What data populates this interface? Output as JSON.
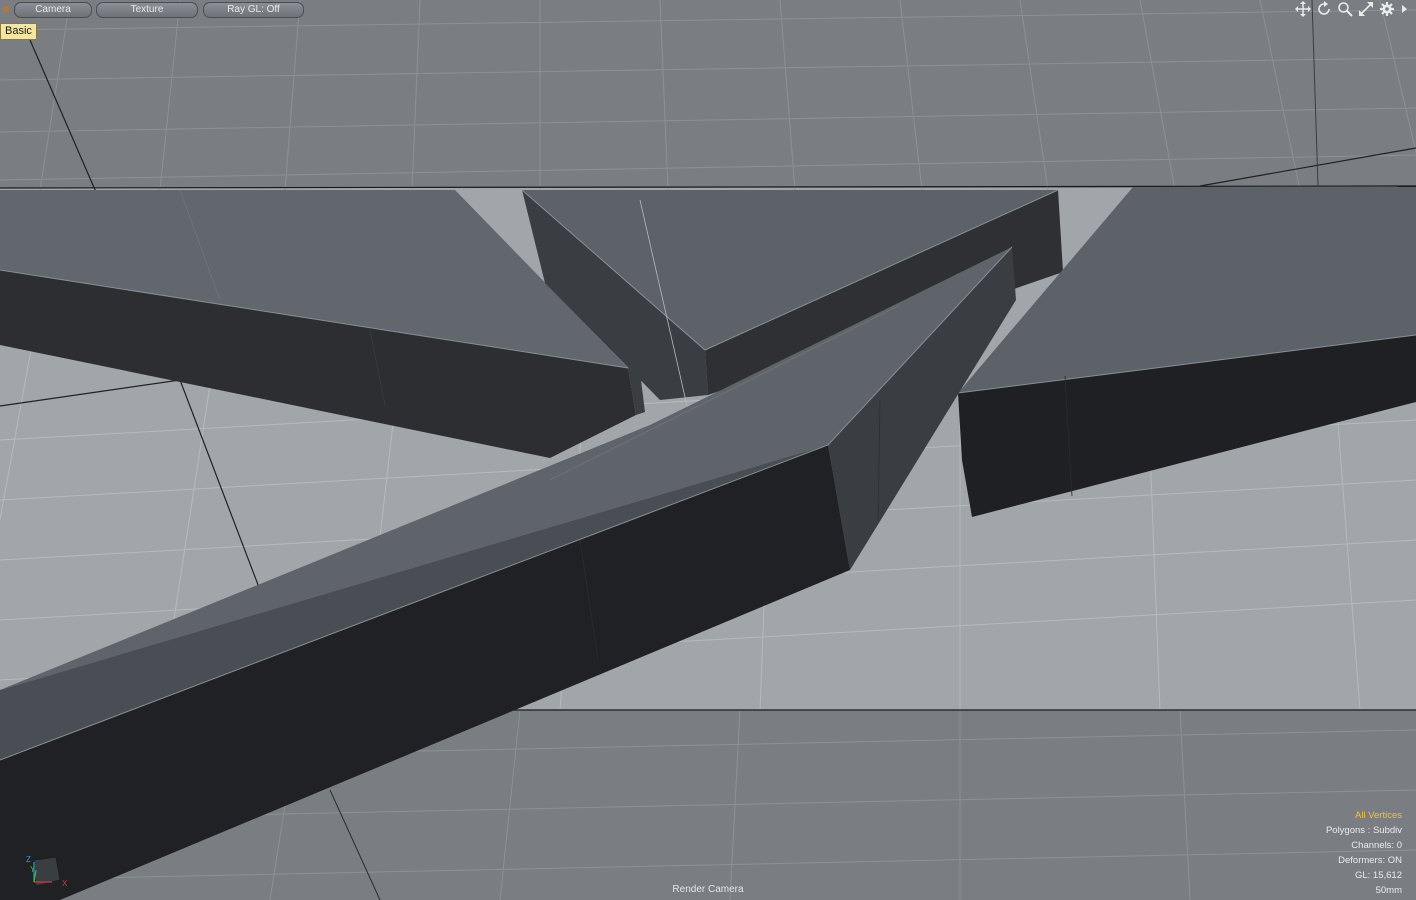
{
  "toolbar": {
    "camera_label": "Camera",
    "texture_label": "Texture",
    "raygl_label": "Ray GL: Off"
  },
  "view_style_tag": "Basic",
  "nav_icons": [
    "move-icon",
    "rotate-icon",
    "zoom-icon",
    "fit-icon",
    "gear-icon",
    "more-arrow-icon"
  ],
  "info_overlay": {
    "selection_mode": "All Vertices",
    "polygons": "Polygons : Subdiv",
    "channels": "Channels: 0",
    "deformers": "Deformers: ON",
    "gl_count": "GL: 15,612",
    "focal_length": "50mm"
  },
  "camera_name": "Render Camera",
  "axis_labels": {
    "x": "X",
    "y": "Y",
    "z": "Z"
  },
  "colors": {
    "grid_bg": "#7d8186",
    "highlight_text": "#f3c13a"
  }
}
